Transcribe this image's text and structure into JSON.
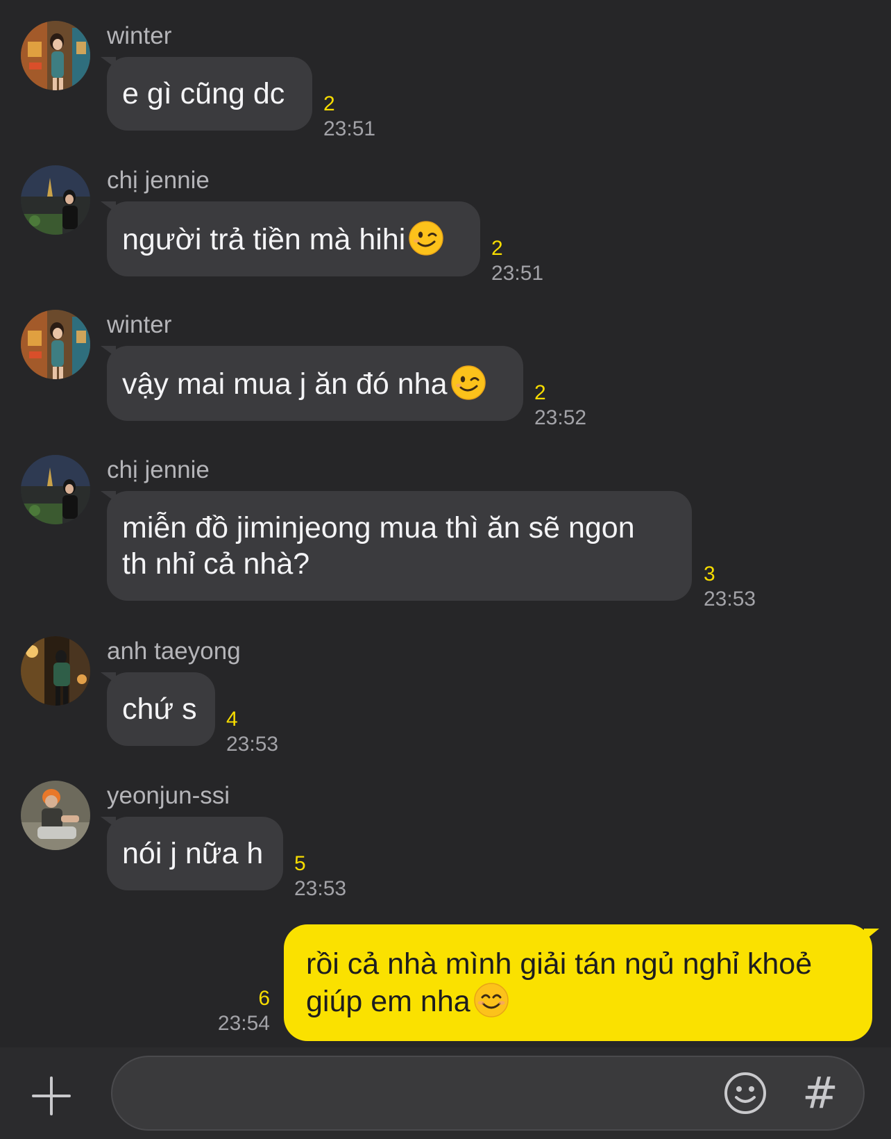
{
  "messages": [
    {
      "sender": "winter",
      "text": "e gì cũng dc",
      "emoji": "",
      "unread": "2",
      "time": "23:51",
      "avatar": "winter-avatar"
    },
    {
      "sender": "chị jennie",
      "text": "người trả tiền mà hihi",
      "emoji": "wink-face",
      "unread": "2",
      "time": "23:51",
      "avatar": "jennie-avatar"
    },
    {
      "sender": "winter",
      "text": "vậy mai mua j ăn đó nha",
      "emoji": "wink-face",
      "unread": "2",
      "time": "23:52",
      "avatar": "winter-avatar"
    },
    {
      "sender": "chị jennie",
      "line1": "miễn đồ jiminjeong mua thì ăn sẽ ngon",
      "line2": "th nhỉ cả nhà?",
      "unread": "3",
      "time": "23:53",
      "avatar": "jennie-avatar"
    },
    {
      "sender": "anh taeyong",
      "text": "chứ s",
      "emoji": "",
      "unread": "4",
      "time": "23:53",
      "avatar": "taeyong-avatar"
    },
    {
      "sender": "yeonjun-ssi",
      "text": "nói j nữa h",
      "emoji": "",
      "unread": "5",
      "time": "23:53",
      "avatar": "yeonjun-avatar"
    }
  ],
  "own_message": {
    "line1": "rồi cả nhà mình giải tán ngủ nghỉ khoẻ",
    "line2": "giúp em nha",
    "emoji": "smiling-face",
    "unread": "6",
    "time": "23:54"
  },
  "input_bar": {
    "plus_icon": "plus-icon",
    "emoji_icon": "emoji-icon",
    "hash_label": "#",
    "value": ""
  },
  "colors": {
    "background": "#262628",
    "bubble": "#3b3b3e",
    "own_bubble": "#fae100",
    "unread": "#f7dc00"
  }
}
